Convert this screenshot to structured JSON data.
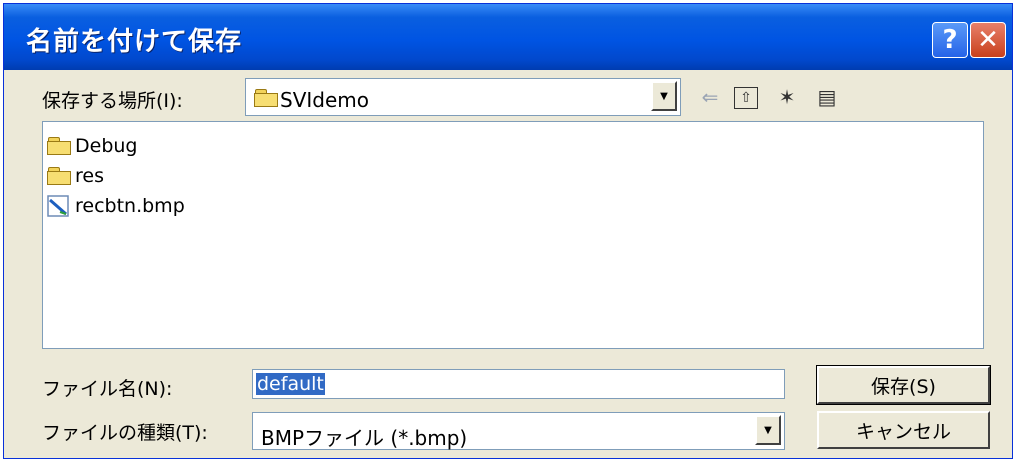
{
  "window": {
    "title": "名前を付けて保存",
    "help": "?",
    "close": "✕"
  },
  "save_in": {
    "label": "保存する場所(I):",
    "value": "SVIdemo"
  },
  "toolbar": {
    "back": "⇐",
    "up": "⇧",
    "new_folder": "✶",
    "view": "▤"
  },
  "files": [
    {
      "name": "Debug",
      "icon": "folder-icon"
    },
    {
      "name": "res",
      "icon": "folder-icon"
    },
    {
      "name": "recbtn.bmp",
      "icon": "bitmap-file-icon"
    }
  ],
  "filename": {
    "label": "ファイル名(N):",
    "value": "default"
  },
  "filetype": {
    "label": "ファイルの種類(T):",
    "value": "BMPファイル (*.bmp)"
  },
  "buttons": {
    "save": "保存(S)",
    "cancel": "キャンセル"
  }
}
